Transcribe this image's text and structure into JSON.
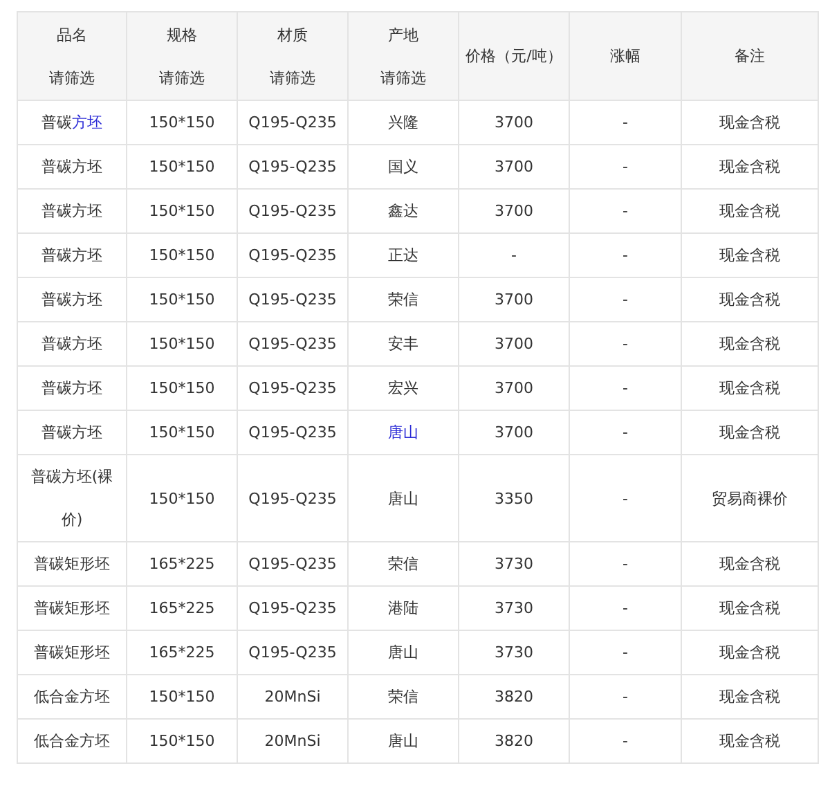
{
  "table": {
    "columns": [
      {
        "label": "品名",
        "filter": "请筛选"
      },
      {
        "label": "规格",
        "filter": "请筛选"
      },
      {
        "label": "材质",
        "filter": "请筛选"
      },
      {
        "label": "产地",
        "filter": "请筛选"
      },
      {
        "label": "价格（元/吨）"
      },
      {
        "label": "涨幅"
      },
      {
        "label": "备注"
      }
    ],
    "rows": [
      {
        "cells": [
          {
            "segments": [
              {
                "text": "普碳",
                "link": false
              },
              {
                "text": "方坯",
                "link": true
              }
            ]
          },
          "150*150",
          "Q195-Q235",
          "兴隆",
          "3700",
          "-",
          "现金含税"
        ]
      },
      {
        "cells": [
          "普碳方坯",
          "150*150",
          "Q195-Q235",
          "国义",
          "3700",
          "-",
          "现金含税"
        ]
      },
      {
        "cells": [
          "普碳方坯",
          "150*150",
          "Q195-Q235",
          "鑫达",
          "3700",
          "-",
          "现金含税"
        ]
      },
      {
        "cells": [
          "普碳方坯",
          "150*150",
          "Q195-Q235",
          "正达",
          "-",
          "-",
          "现金含税"
        ]
      },
      {
        "cells": [
          "普碳方坯",
          "150*150",
          "Q195-Q235",
          "荣信",
          "3700",
          "-",
          "现金含税"
        ]
      },
      {
        "cells": [
          "普碳方坯",
          "150*150",
          "Q195-Q235",
          "安丰",
          "3700",
          "-",
          "现金含税"
        ]
      },
      {
        "cells": [
          "普碳方坯",
          "150*150",
          "Q195-Q235",
          "宏兴",
          "3700",
          "-",
          "现金含税"
        ]
      },
      {
        "cells": [
          "普碳方坯",
          "150*150",
          "Q195-Q235",
          {
            "segments": [
              {
                "text": "唐山",
                "link": true
              }
            ]
          },
          "3700",
          "-",
          "现金含税"
        ]
      },
      {
        "cells": [
          "普碳方坯(裸价)",
          "150*150",
          "Q195-Q235",
          "唐山",
          "3350",
          "-",
          "贸易商裸价"
        ]
      },
      {
        "cells": [
          "普碳矩形坯",
          "165*225",
          "Q195-Q235",
          "荣信",
          "3730",
          "-",
          "现金含税"
        ]
      },
      {
        "cells": [
          "普碳矩形坯",
          "165*225",
          "Q195-Q235",
          "港陆",
          "3730",
          "-",
          "现金含税"
        ]
      },
      {
        "cells": [
          "普碳矩形坯",
          "165*225",
          "Q195-Q235",
          "唐山",
          "3730",
          "-",
          "现金含税"
        ]
      },
      {
        "cells": [
          "低合金方坯",
          "150*150",
          "20MnSi",
          "荣信",
          "3820",
          "-",
          "现金含税"
        ]
      },
      {
        "cells": [
          "低合金方坯",
          "150*150",
          "20MnSi",
          "唐山",
          "3820",
          "-",
          "现金含税"
        ]
      }
    ]
  }
}
